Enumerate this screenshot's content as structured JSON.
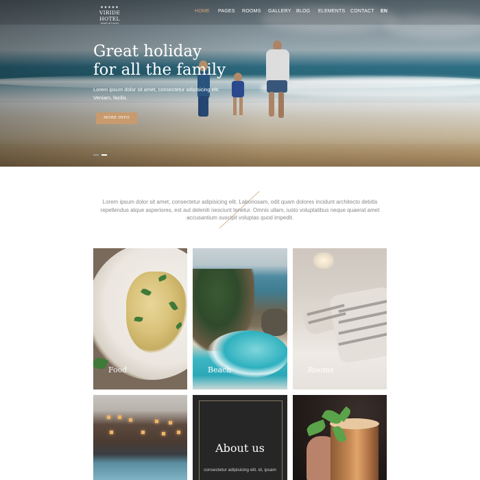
{
  "brand": {
    "stars": "★★★★★",
    "name": "VIRIDE HOTEL",
    "tagline": "resort of luxury"
  },
  "nav": {
    "items": [
      "HOME",
      "PAGES",
      "ROOMS",
      "GALLERY",
      "BLOG",
      "ELEMENTS",
      "CONTACT"
    ],
    "active": "HOME",
    "language": "EN"
  },
  "hero": {
    "title_line1": "Great holiday",
    "title_line2": "for all the family",
    "subtitle": "Lorem ipsum dolor sit amet, consectetur adipisicing elit. Veniam, facilis.",
    "button": "MORE INFO",
    "slides": 2,
    "active_slide": 2
  },
  "intro": {
    "text": "Lorem ipsum dolor sit amet, consectetur adipisicing elit. Laboriosam, odit quam dolores incidunt architecto debitis repellendus atque asperiores, est aut deleniti nesciunt tenetur. Omnis ullam, iusto voluptatibus neque quaerat amet accusantium suscipit voluptas quod impedit."
  },
  "tiles": {
    "food": "Food",
    "beach": "Beach",
    "rooms": "Rooms",
    "about_title": "About us",
    "about_text": "consectetur adipisicing elit. id, ipsam"
  },
  "colors": {
    "accent": "#c89a6d",
    "active_nav": "#d9a87a",
    "about_bg": "#262626"
  }
}
